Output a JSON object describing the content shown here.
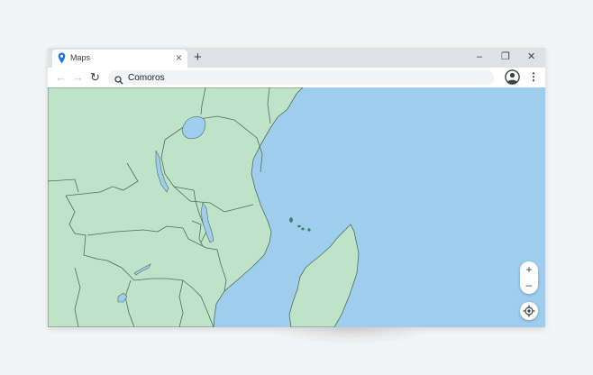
{
  "browser": {
    "tab": {
      "title": "Maps",
      "close_glyph": "×",
      "icon": "map-pin-icon"
    },
    "new_tab_glyph": "+",
    "window_controls": {
      "minimize": "–",
      "restore": "❐",
      "close": "✕"
    },
    "nav": {
      "back": "←",
      "forward": "→",
      "reload": "↻"
    },
    "address": {
      "value": "Comoros",
      "icon": "search-icon"
    },
    "menu_glyph": "⋮"
  },
  "map": {
    "zoom_in": "+",
    "zoom_out": "–",
    "locate_icon": "crosshair-icon",
    "colors": {
      "water": "#9fcdee",
      "land": "#bfe3c8",
      "border": "#4d6f58"
    }
  }
}
